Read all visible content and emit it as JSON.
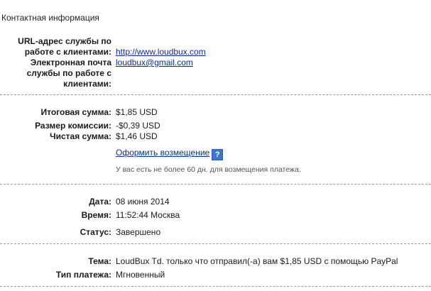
{
  "contact": {
    "title": "Контактная информация",
    "url_label_1": "URL-адрес службы по",
    "url_label_2": "работе с клиентами:",
    "url_value": "http://www.loudbux.com",
    "email_label_1": "Электронная почта",
    "email_label_2": "службы по работе с",
    "email_label_3": "клиентами:",
    "email_value": "loudbux@gmail.com"
  },
  "amounts": {
    "total_label": "Итоговая сумма:",
    "total_value": "$1,85 USD",
    "fee_label": "Размер комиссии:",
    "fee_value": "-$0,39 USD",
    "net_label": "Чистая сумма:",
    "net_value": "$1,46 USD",
    "refund_link": "Оформить возмещение",
    "help_icon": "?",
    "refund_note": "У вас есть не более 60 дн. для возмещения платежа."
  },
  "details": {
    "date_label": "Дата:",
    "date_value": "08 июня 2014",
    "time_label": "Время:",
    "time_value": "11:52:44 Москва",
    "status_label": "Статус:",
    "status_value": "Завершено"
  },
  "payment": {
    "subject_label": "Тема:",
    "subject_value": "LoudBux Td. только что отправил(-а) вам $1,85 USD с помощью PayPal",
    "type_label": "Тип платежа:",
    "type_value": "Мгновенный"
  }
}
